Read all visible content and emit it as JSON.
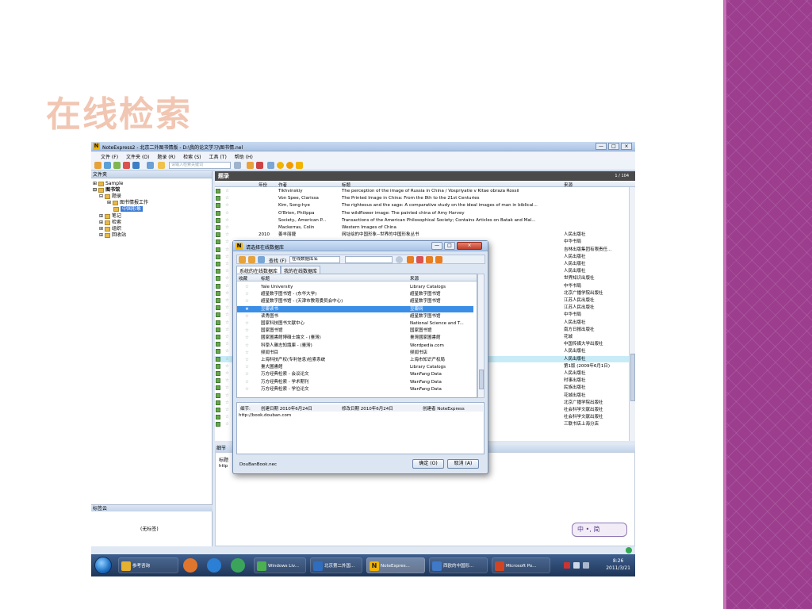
{
  "slide": {
    "title": "在线检索"
  },
  "window": {
    "title": "NoteExpress2 - 北京二外图书情版 - D:\\我的论文学习\\图书情.nel",
    "app_icon": "N",
    "controls": [
      "—",
      "□",
      "⨯"
    ]
  },
  "menubar": [
    "文件 (F)",
    "文件夹 (O)",
    "题录 (R)",
    "检索 (S)",
    "工具 (T)",
    "帮助 (H)"
  ],
  "toolbar": {
    "search_placeholder": "请输入检索关键词"
  },
  "left_pane": {
    "header": "文件夹",
    "tree": [
      "Sample",
      "图书馆",
      "题录",
      "图书情报工作",
      "中国形象",
      "笔记",
      "检索",
      "组织",
      "回收站"
    ],
    "tags_header": "标签云",
    "no_tags": "(无标签)"
  },
  "main_pane": {
    "header": "题录",
    "count": "1 / 104",
    "columns": {
      "year": "年份",
      "author": "作者",
      "title": "标题",
      "source": "来源"
    },
    "rows": [
      {
        "year": "",
        "author": "Tikhvinskiy",
        "title": "The perception of the image of Russia in China / Vospriyatie v Kitae obraza Rossii",
        "source": ""
      },
      {
        "year": "",
        "author": "Von Spee, Clarissa",
        "title": "The Printed Image in China: From the 8th to the 21st Centuries",
        "source": ""
      },
      {
        "year": "",
        "author": "Kim, Song-hye",
        "title": "The righteous and the sage: A comparative study on the ideal images of man in biblical...",
        "source": ""
      },
      {
        "year": "",
        "author": "O'Brien, Philippa",
        "title": "The wildflower image: The painted china of Amy Harvey",
        "source": ""
      },
      {
        "year": "",
        "author": "Society., American P...",
        "title": "Transactions of the American Philosophical Society; Contains Articles on Batak and Mal...",
        "source": ""
      },
      {
        "year": "",
        "author": "Mackerras, Colin",
        "title": "Western Images of China",
        "source": ""
      },
      {
        "year": "2010",
        "author": "姜丰丽捷",
        "title": "网址绘的中国形象--世界的中国形象丛书",
        "source": "人民出版社"
      },
      {
        "year": "",
        "author": "",
        "title": "",
        "source": "中华书局"
      },
      {
        "year": "",
        "author": "",
        "title": "",
        "source": "吉林出版集团有限责任..."
      },
      {
        "year": "",
        "author": "",
        "title": "",
        "source": "人民出版社"
      },
      {
        "year": "",
        "author": "",
        "title": "",
        "source": "人民出版社"
      },
      {
        "year": "",
        "author": "",
        "title": "",
        "source": "人民出版社"
      },
      {
        "year": "",
        "author": "",
        "title": "3-2002)",
        "source": "世界知识出版社"
      },
      {
        "year": "",
        "author": "",
        "title": "",
        "source": "中华书局"
      },
      {
        "year": "",
        "author": "",
        "title": "",
        "source": "北京广播学院出版社"
      },
      {
        "year": "",
        "author": "",
        "title": "",
        "source": "江苏人民出版社"
      },
      {
        "year": "",
        "author": "",
        "title": "",
        "source": "江苏人民出版社"
      },
      {
        "year": "",
        "author": "",
        "title": "",
        "source": "中华书局"
      },
      {
        "year": "",
        "author": "",
        "title": "",
        "source": "人民出版社"
      },
      {
        "year": "",
        "author": "",
        "title": "",
        "source": "南方日报出版社"
      },
      {
        "year": "",
        "author": "",
        "title": "",
        "source": "花城"
      },
      {
        "year": "",
        "author": "",
        "title": "",
        "source": "中国传媒大学出版社"
      },
      {
        "year": "",
        "author": "",
        "title": "",
        "source": "人民出版社"
      },
      {
        "year": "",
        "author": "",
        "title": "",
        "source": "人民出版社"
      },
      {
        "year": "",
        "author": "",
        "title": "",
        "source": "第1版 (2009年6月1日)"
      },
      {
        "year": "",
        "author": "",
        "title": "",
        "source": "人民出版社"
      },
      {
        "year": "",
        "author": "",
        "title": "",
        "source": "时事出版社"
      },
      {
        "year": "",
        "author": "",
        "title": "",
        "source": "民族出版社"
      },
      {
        "year": "",
        "author": "",
        "title": "",
        "source": "花城出版社"
      },
      {
        "year": "",
        "author": "",
        "title": "",
        "source": "北京广播学院出版社"
      },
      {
        "year": "",
        "author": "",
        "title": "",
        "source": "社会科学文献出版社"
      },
      {
        "year": "",
        "author": "",
        "title": "",
        "source": "社会科学文献出版社"
      },
      {
        "year": "",
        "author": "",
        "title": "",
        "source": "三联书店上海分店"
      }
    ]
  },
  "details": {
    "header": "细节",
    "label": "标题",
    "url": "http"
  },
  "ime": {
    "text": "中 •, 简"
  },
  "dialog": {
    "title": "请选择在线数据库",
    "toolbar": {
      "find_label": "查找 (F)",
      "field_combo": "在线数据库名"
    },
    "tabs": [
      "系统的在线数据库",
      "我的在线数据库"
    ],
    "columns": {
      "fav": "收藏",
      "title": "标题",
      "source": "来源"
    },
    "rows": [
      {
        "title": "Yale University",
        "source": "Library Catalogs"
      },
      {
        "title": "超星数字图书馆 - (东华大学)",
        "source": "超星数字图书馆"
      },
      {
        "title": "超星数字图书馆 - (天津市教育委员会中心)",
        "source": "超星数字图书馆"
      },
      {
        "title": "豆瓣读书",
        "source": "豆瓣网"
      },
      {
        "title": "读秀图书",
        "source": "超星数字图书馆"
      },
      {
        "title": "国家科技图书文献中心",
        "source": "National Science and T..."
      },
      {
        "title": "国家图书馆",
        "source": "国家图书馆"
      },
      {
        "title": "國家圖書館博碩士論文 - (臺灣)",
        "source": "臺灣國家圖書館"
      },
      {
        "title": "科學人雜志知識庫 - (臺灣)",
        "source": "Wordpedia.com"
      },
      {
        "title": "频闻书目",
        "source": "频闻书店"
      },
      {
        "title": "上海科技产权(专利信息)检索系统",
        "source": "上海市知识产权局"
      },
      {
        "title": "臺大圖書館",
        "source": "Library Catalogs"
      },
      {
        "title": "万方经典检索 - 会议论文",
        "source": "WanFang Data"
      },
      {
        "title": "万方经典检索 - 学术期刊",
        "source": "WanFang Data"
      },
      {
        "title": "万方经典检索 - 学位论文",
        "source": "WanFang Data"
      }
    ],
    "selected_index": 3,
    "details": {
      "section": "细节:",
      "created": "创建日期 2010年6月24日",
      "modified": "修改日期 2010年6月24日",
      "creator": "创建者 NoteExpress",
      "url": "http://book.douban.com"
    },
    "file": "DouBanBook.nec",
    "ok_label": "确定 (O)",
    "cancel_label": "取消 (A)"
  },
  "taskbar": {
    "tasks": [
      "参考咨询",
      "Windows Liv...",
      "北京第二外国...",
      "NoteExpres...",
      "西欧的中国形...",
      "Microsoft Po..."
    ],
    "time": "8:26",
    "date": "2011/3/21"
  },
  "colors": {
    "band": "#9c3d8e",
    "title": "#f1c6b2",
    "selection": "#3b8ee6"
  }
}
